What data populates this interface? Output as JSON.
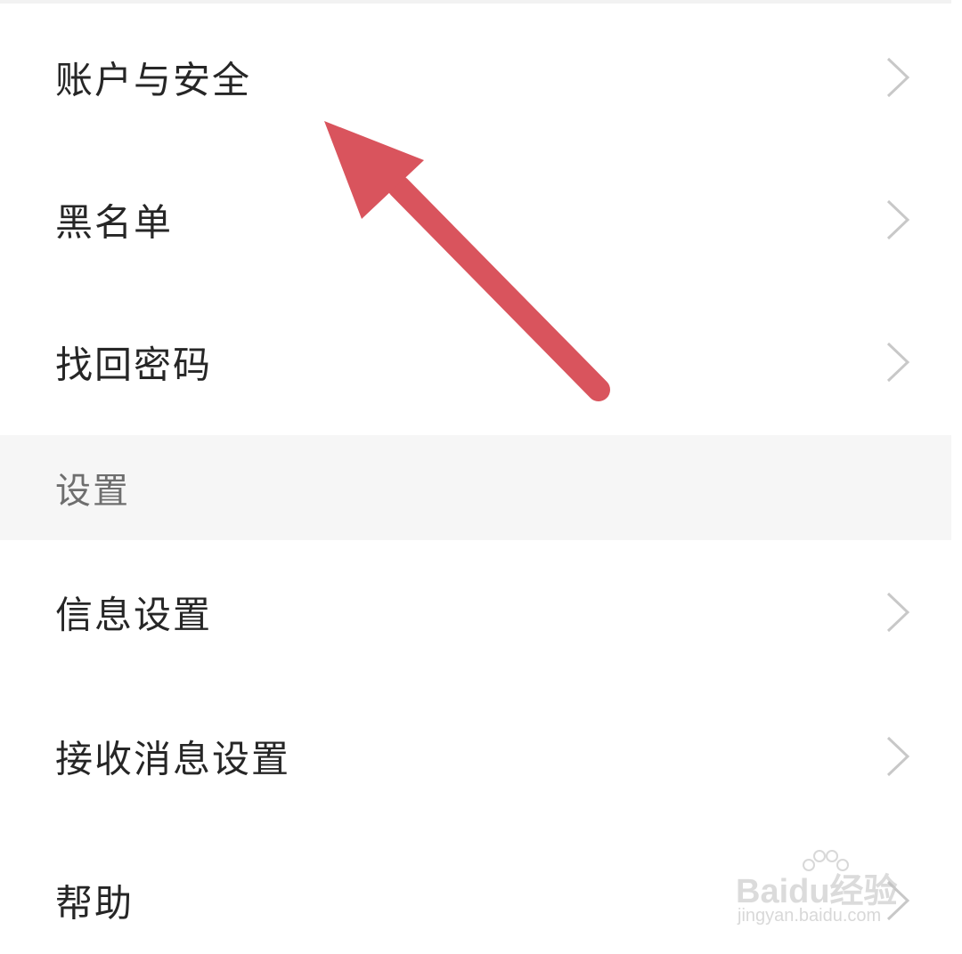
{
  "menu": {
    "account_items": [
      {
        "label": "账户与安全",
        "icon": "chevron-right-icon"
      },
      {
        "label": "黑名单",
        "icon": "chevron-right-icon"
      },
      {
        "label": "找回密码",
        "icon": "chevron-right-icon"
      }
    ],
    "settings_section": {
      "title": "设置",
      "items": [
        {
          "label": "信息设置",
          "icon": "chevron-right-icon"
        },
        {
          "label": "接收消息设置",
          "icon": "chevron-right-icon"
        },
        {
          "label": "帮助",
          "icon": "chevron-right-icon"
        }
      ]
    }
  },
  "annotation": {
    "type": "arrow",
    "color": "#d9545d",
    "points_to": "账户与安全"
  },
  "watermark": {
    "brand": "Baidu经验",
    "url": "jingyan.baidu.com"
  },
  "colors": {
    "background": "#ffffff",
    "section_background": "#f6f6f6",
    "text_primary": "#262626",
    "text_section": "#6e6e6e",
    "chevron": "#c8c8c8"
  }
}
